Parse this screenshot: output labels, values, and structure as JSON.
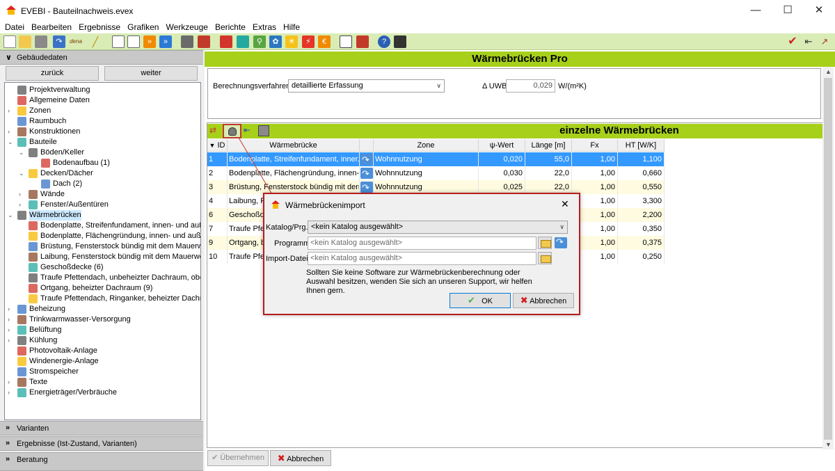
{
  "window": {
    "title": "EVEBI - Bauteilnachweis.evex"
  },
  "menu": [
    "Datei",
    "Bearbeiten",
    "Ergebnisse",
    "Grafiken",
    "Werkzeuge",
    "Berichte",
    "Extras",
    "Hilfe"
  ],
  "toolbar": {
    "dena_label": "dena"
  },
  "left": {
    "section_top": "Gebäudedaten",
    "back": "zurück",
    "next": "weiter",
    "tree": [
      {
        "label": "Projektverwaltung",
        "level": 1,
        "exp": ""
      },
      {
        "label": "Allgemeine Daten",
        "level": 1,
        "exp": ""
      },
      {
        "label": "Zonen",
        "level": 1,
        "exp": "›"
      },
      {
        "label": "Raumbuch",
        "level": 1,
        "exp": ""
      },
      {
        "label": "Konstruktionen",
        "level": 1,
        "exp": "›"
      },
      {
        "label": "Bauteile",
        "level": 1,
        "exp": "⌄"
      },
      {
        "label": "Böden/Keller",
        "level": 2,
        "exp": "⌄"
      },
      {
        "label": "Bodenaufbau (1)",
        "level": 3,
        "exp": ""
      },
      {
        "label": "Decken/Dächer",
        "level": 2,
        "exp": "⌄"
      },
      {
        "label": "Dach (2)",
        "level": 3,
        "exp": ""
      },
      {
        "label": "Wände",
        "level": 2,
        "exp": "›"
      },
      {
        "label": "Fenster/Außentüren",
        "level": 2,
        "exp": "›"
      },
      {
        "label": "Wärmebrücken",
        "level": 1,
        "exp": "⌄",
        "selected": true
      },
      {
        "label": "Bodenplatte, Streifenfundament, innen- und auße",
        "level": 2,
        "exp": ""
      },
      {
        "label": "Bodenplatte, Flächengründung, innen- und außen",
        "level": 2,
        "exp": ""
      },
      {
        "label": "Brüstung, Fensterstock bündig mit dem Mauerwer",
        "level": 2,
        "exp": ""
      },
      {
        "label": "Laibung, Fensterstock bündig mit dem Mauerwerk",
        "level": 2,
        "exp": ""
      },
      {
        "label": "Geschoßdecke (6)",
        "level": 2,
        "exp": ""
      },
      {
        "label": "Traufe Pfettendach, unbeheizter Dachraum, ober",
        "level": 2,
        "exp": ""
      },
      {
        "label": "Ortgang, beheizter Dachraum (9)",
        "level": 2,
        "exp": ""
      },
      {
        "label": "Traufe Pfettendach, Ringanker, beheizter Dachra",
        "level": 2,
        "exp": ""
      },
      {
        "label": "Beheizung",
        "level": 1,
        "exp": "›"
      },
      {
        "label": "Trinkwarmwasser-Versorgung",
        "level": 1,
        "exp": "›"
      },
      {
        "label": "Belüftung",
        "level": 1,
        "exp": "›"
      },
      {
        "label": "Kühlung",
        "level": 1,
        "exp": "›"
      },
      {
        "label": "Photovoltaik-Anlage",
        "level": 1,
        "exp": ""
      },
      {
        "label": "Windenergie-Anlage",
        "level": 1,
        "exp": ""
      },
      {
        "label": "Stromspeicher",
        "level": 1,
        "exp": ""
      },
      {
        "label": "Texte",
        "level": 1,
        "exp": "›"
      },
      {
        "label": "Energieträger/Verbräuche",
        "level": 1,
        "exp": "›"
      }
    ],
    "sections_bottom": [
      "Varianten",
      "Ergebnisse (Ist-Zustand, Varianten)",
      "Beratung"
    ]
  },
  "main": {
    "title": "Wärmebrücken Pro",
    "calc_label": "Berechnungsverfahren",
    "calc_value": "detaillierte Erfassung",
    "uwb_label": "Δ UWB",
    "uwb_value": "0,029",
    "uwb_unit": "W/(m²K)",
    "subtitle": "einzelne Wärmebrücken",
    "columns": {
      "id": "ID",
      "name": "Wärmebrücke",
      "zone": "Zone",
      "psi": "ψ-Wert",
      "len": "Länge [m]",
      "fx": "Fx",
      "ht": "HT [W/K]"
    },
    "rows": [
      {
        "id": "1",
        "name": "Bodenplatte, Streifenfundament, inner...",
        "zone": "Wohnnutzung",
        "psi": "0,020",
        "len": "55,0",
        "fx": "1,00",
        "ht": "1,100"
      },
      {
        "id": "2",
        "name": "Bodenplatte, Flächengründung, innen-...",
        "zone": "Wohnnutzung",
        "psi": "0,030",
        "len": "22,0",
        "fx": "1,00",
        "ht": "0,660"
      },
      {
        "id": "3",
        "name": "Brüstung, Fensterstock bündig mit derr...",
        "zone": "Wohnnutzung",
        "psi": "0,025",
        "len": "22,0",
        "fx": "1,00",
        "ht": "0,550"
      },
      {
        "id": "4",
        "name": "Laibung, Fe",
        "zone": "",
        "psi": "",
        "len": "",
        "fx": "1,00",
        "ht": "3,300"
      },
      {
        "id": "6",
        "name": "Geschoßde",
        "zone": "",
        "psi": "",
        "len": "",
        "fx": "1,00",
        "ht": "2,200"
      },
      {
        "id": "7",
        "name": "Traufe Pfet",
        "zone": "",
        "psi": "",
        "len": "",
        "fx": "1,00",
        "ht": "0,350"
      },
      {
        "id": "9",
        "name": "Ortgang, b",
        "zone": "",
        "psi": "",
        "len": "",
        "fx": "1,00",
        "ht": "0,375"
      },
      {
        "id": "10",
        "name": "Traufe Pfet",
        "zone": "",
        "psi": "",
        "len": "",
        "fx": "1,00",
        "ht": "0,250"
      }
    ],
    "apply": "Übernehmen",
    "cancel": "Abbrechen"
  },
  "dialog": {
    "title": "Wärmebrückenimport",
    "katalog_label": "Katalog/Prg.",
    "katalog_value": "<kein Katalog ausgewählt>",
    "programm_label": "Programm",
    "programm_value": "<kein Katalog ausgewählt>",
    "import_label": "Import-Datei",
    "import_value": "<kein Katalog ausgewählt>",
    "info": "Sollten Sie keine Software zur Wärmebrückenberechnung oder Auswahl besitzen, wenden Sie sich an unseren Support, wir helfen Ihnen gern.",
    "ok": "OK",
    "cancel": "Abbrechen",
    "close": "✕"
  },
  "colors": {
    "accent_green": "#a7d01b",
    "toolbar_green": "#d9ecb6",
    "selection": "#3399ff",
    "dialog_border": "#b71c1c"
  }
}
